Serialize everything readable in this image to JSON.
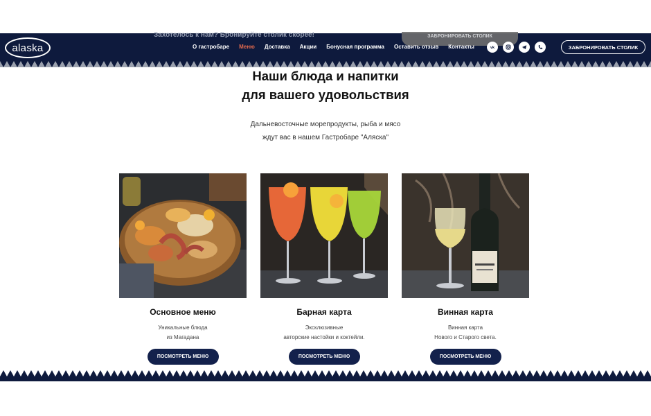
{
  "header": {
    "logo_text": "alaska",
    "promo_text": "Захотелось к нам? Бронируйте столик скорее!",
    "promo_pill_label": "ЗАБРОНИРОВАТЬ СТОЛИК",
    "nav": [
      {
        "label": "О гастробаре",
        "active": false
      },
      {
        "label": "Меню",
        "active": true
      },
      {
        "label": "Доставка",
        "active": false
      },
      {
        "label": "Акции",
        "active": false
      },
      {
        "label": "Бонусная программа",
        "active": false
      },
      {
        "label": "Оставить отзыв",
        "active": false
      },
      {
        "label": "Контакты",
        "active": false
      }
    ],
    "socials": [
      "vk-icon",
      "instagram-icon",
      "telegram-icon",
      "phone-icon"
    ],
    "book_button_label": "ЗАБРОНИРОВАТЬ СТОЛИК"
  },
  "hero": {
    "title_line1": "Наши блюда и напитки",
    "title_line2": "для вашего удовольствия",
    "subtitle_line1": "Дальневосточные морепродукты, рыба и мясо",
    "subtitle_line2": "ждут вас в нашем Гастробаре \"Аляска\""
  },
  "cards": [
    {
      "title": "Основное меню",
      "desc_line1": "Уникальные блюда",
      "desc_line2": "из Магадана",
      "button_label": "ПОСМОТРЕТЬ МЕНЮ"
    },
    {
      "title": "Барная карта",
      "desc_line1": "Эксклюзивные",
      "desc_line2": "авторские настойки и коктейли.",
      "button_label": "ПОСМОТРЕТЬ МЕНЮ"
    },
    {
      "title": "Винная карта",
      "desc_line1": "Винная карта",
      "desc_line2": "Нового и Старого света.",
      "button_label": "ПОСМОТРЕТЬ МЕНЮ"
    }
  ],
  "colors": {
    "header_bg": "#0e1a3d",
    "accent_active_nav": "#e0694d",
    "button_bg": "#13214c"
  }
}
